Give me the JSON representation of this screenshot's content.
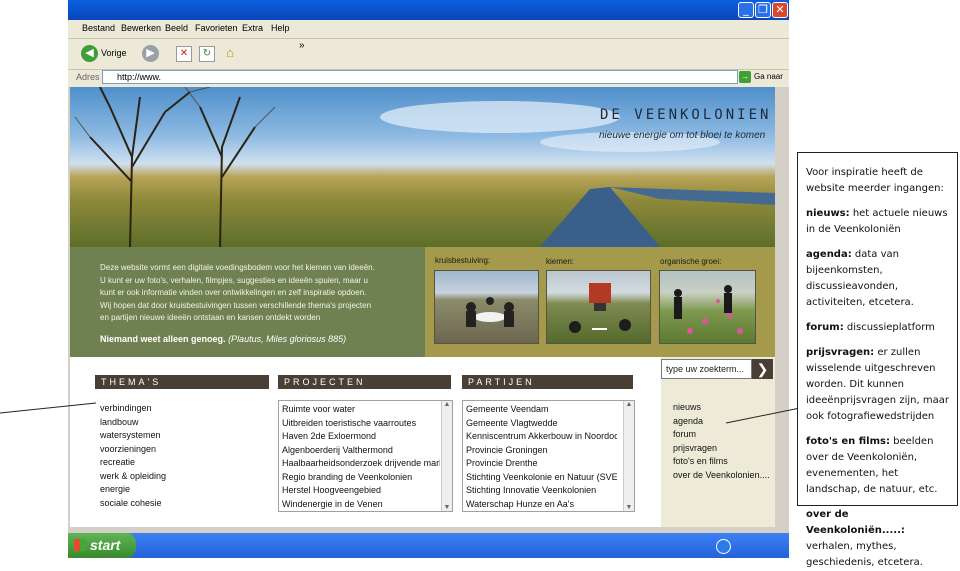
{
  "menu": [
    "Bestand",
    "Bewerken",
    "Beeld",
    "Favorieten",
    "Extra",
    "Help"
  ],
  "toolbar": {
    "back_label": "Vorige",
    "chevron": "»"
  },
  "address": {
    "label": "Adres",
    "value": "http://www.",
    "go_label": "Ga naar"
  },
  "site": {
    "title": "de Veenkolonien",
    "tagline": "nieuwe energie om tot bloei te komen",
    "intro_lines": [
      "Deze website vormt een digitale voedingsbodem voor het kiemen van ideeën.",
      "U kunt er uw foto's, verhalen, filmpjes, suggesties en ideeën spuien, maar u",
      "kunt er ook informatie vinden over ontwikkelingen en zelf inspiratie opdoen.",
      "Wij hopen dat door kruisbestuivingen tussen verschillende thema's projecten",
      "en partijen nieuwe ideeën ontstaan en kansen ontdekt worden"
    ],
    "quote_bold": "Niemand weet alleen genoeg.",
    "quote_rest": "(Plautus, Miles gloriosus 885)",
    "photo_labels": [
      "kruisbestuiving:",
      "kiemen:",
      "organische groei:"
    ],
    "search_placeholder": "type uw zoekterm..."
  },
  "themes": {
    "heading": "THEMA'S",
    "items": [
      "verbindingen",
      "landbouw",
      "watersystemen",
      "voorzieningen",
      "recreatie",
      "werk & opleiding",
      "energie",
      "sociale cohesie"
    ]
  },
  "projects": {
    "heading": "PROJECTEN",
    "items": [
      "Ruimte voor water",
      "Uitbreiden toeristische vaarroutes",
      "Haven 2de Exloermond",
      "Algenboerderij Valthermond",
      "Haalbaarheidsonderzoek drijvende markt",
      "Regio branding de Veenkolonien",
      "Herstel Hoogveengebied",
      "Windenergie in de Venen"
    ]
  },
  "parties": {
    "heading": "PARTIJEN",
    "items": [
      "Gemeente Veendam",
      "Gemeente Vlagtwedde",
      "Kenniscentrum Akkerbouw in Noordoos",
      "Provincie Groningen",
      "Provincie Drenthe",
      "Stichting Veenkolonie en Natuur (SVEN",
      "Stichting Innovatie Veenkolonien",
      "Waterschap Hunze en Aa's"
    ]
  },
  "sitenav": [
    "nieuws",
    "agenda",
    "forum",
    "prijsvragen",
    "foto's en films",
    "over de Veenkolonien...."
  ],
  "callout": {
    "intro": "Voor inspiratie heeft de website meerder ingangen:",
    "entries": [
      {
        "term": "nieuws:",
        "text": " het actuele nieuws in de Veenkoloniën"
      },
      {
        "term": "agenda:",
        "text": " data van bijeenkomsten, discussieavonden, activiteiten, etcetera."
      },
      {
        "term": "forum:",
        "text": " discussieplatform"
      },
      {
        "term": "prijsvragen:",
        "text": " er zullen wisselende uitgeschreven worden. Dit kunnen ideeënprijsvragen zijn, maar ook fotografiewedstrijden"
      },
      {
        "term": "foto's en films:",
        "text": " beelden over de Veenkoloniën, evenementen, het landschap, de natuur, etc."
      },
      {
        "term": "over de Veenkoloniën.....:",
        "text": " verhalen, mythes, geschiedenis, etcetera."
      }
    ]
  },
  "taskbar": {
    "start_label": "start"
  }
}
